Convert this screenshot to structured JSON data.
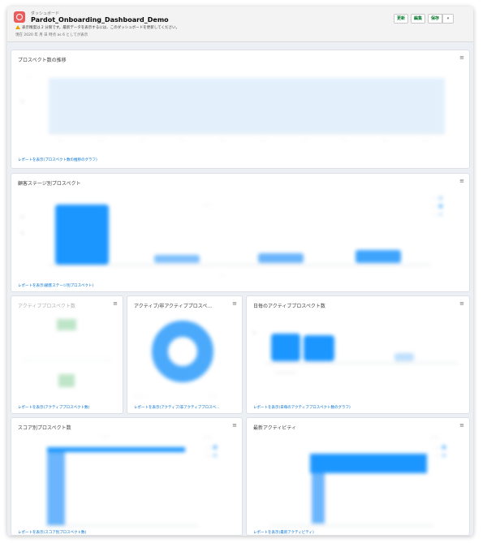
{
  "header": {
    "type_label": "ダッシュボード",
    "title": "Pardot_Onboarding_Dashboard_Demo",
    "warning": "表示精度は 2 分限です。最新データを表示するには、このダッシュボードを更新してください。",
    "as_of": "現在 2020 年 月 日 時点 as 6 としてが表示",
    "buttons": [
      "更新",
      "編集",
      "保存"
    ],
    "more_icon": "chevron-down-icon"
  },
  "cards": {
    "trend": {
      "title": "プロスペクト数の推移",
      "link": "レポートを表示(プロスペクト数の推移のグラフ)"
    },
    "lifecycle": {
      "title": "顧客ステージ別プロスペクト",
      "link": "レポートを表示(顧客ステージ別プロスペクト)"
    },
    "active_count": {
      "title": "アクティブプロスペクト数",
      "link": "レポートを表示(アクティブプロスペクト数)"
    },
    "active_ratio": {
      "title": "アクティブ/非アクティブプロスペ...",
      "link": "レポートを表示(アクティブ/非アクティブプロスペ..."
    },
    "daily": {
      "title": "日毎のアクティブプロスペクト数",
      "link": "レポートを表示(日毎のアクティブプロスペクト数のグラフ)"
    },
    "score": {
      "title": "スコア別プロスペクト数",
      "link": "レポートを表示(スコア別プロスペクト数)"
    },
    "recent": {
      "title": "最新アクティビティ",
      "link": "レポートを表示(最新アクティビティ)"
    }
  },
  "colors": {
    "bar": "#1b96ff",
    "accent": "#0070d2",
    "warning": "#e9a100",
    "logo": "#e95c5c"
  }
}
